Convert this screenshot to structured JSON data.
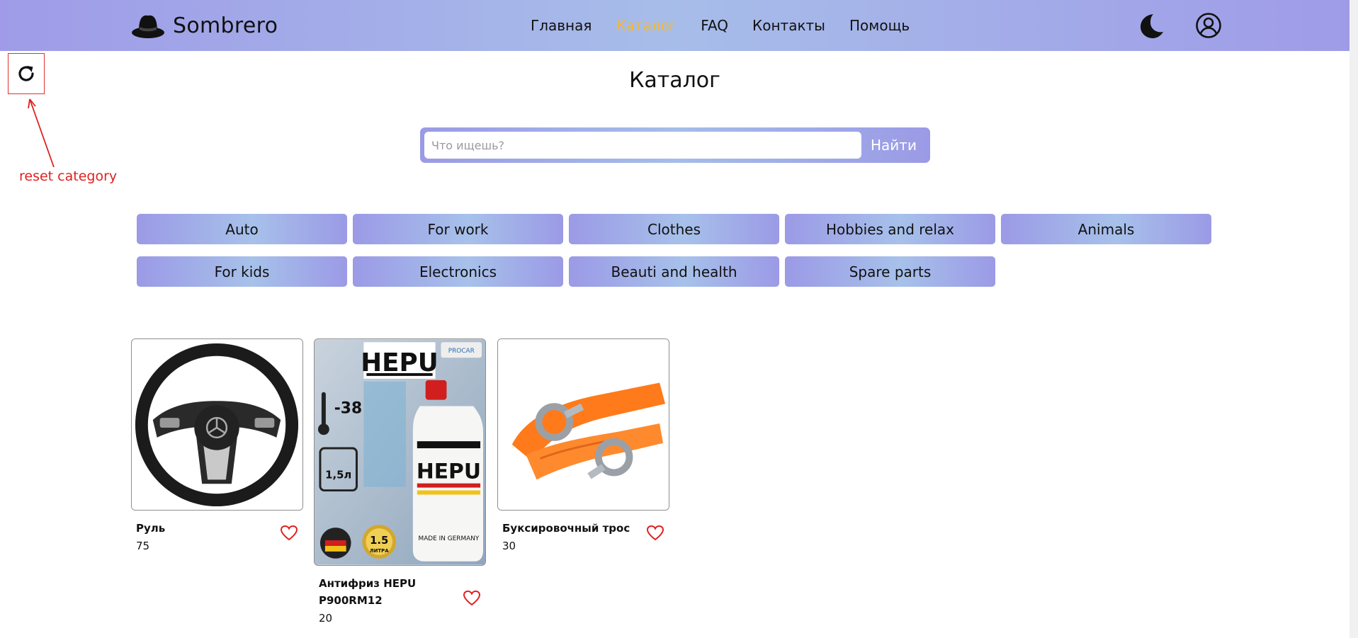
{
  "header": {
    "logo_text": "Sombrero",
    "logo_icon": "hat-icon",
    "nav": [
      {
        "label": "Главная",
        "active": false
      },
      {
        "label": "Каталог",
        "active": true
      },
      {
        "label": "FAQ",
        "active": false
      },
      {
        "label": "Контакты",
        "active": false
      },
      {
        "label": "Помощь",
        "active": false
      }
    ],
    "theme_icon": "moon-icon",
    "profile_icon": "user-circle-icon"
  },
  "annotation": {
    "label": "reset category",
    "icon": "refresh-icon",
    "color": "#e02020"
  },
  "page": {
    "title": "Каталог"
  },
  "search": {
    "placeholder": "Что ищешь?",
    "value": "",
    "button_label": "Найти"
  },
  "categories": [
    "Auto",
    "For work",
    "Clothes",
    "Hobbies and relax",
    "Animals",
    "For kids",
    "Electronics",
    "Beauti and health",
    "Spare parts"
  ],
  "products": [
    {
      "name_lines": [
        "Руль"
      ],
      "price": "75",
      "image": "steering-wheel-image"
    },
    {
      "name_lines": [
        "Антифриз HEPU",
        "P900RM12"
      ],
      "price": "20",
      "image": "antifreeze-bottle-image",
      "image_text": {
        "brand": "HEPU",
        "badge": "PROCAR",
        "temperature": "-38",
        "volume": "1,5л",
        "seal": "1.5",
        "seal_unit": "ЛИТРА",
        "bottle_tag": "MADE IN GERMANY"
      }
    },
    {
      "name_lines": [
        "Буксировочный трос"
      ],
      "price": "30",
      "image": "tow-strap-image"
    }
  ],
  "colors": {
    "header_gradient": [
      "#9f9be8",
      "#a7bde9"
    ],
    "nav_active": "#f5b82e",
    "favorite_icon": "#e02020",
    "annotation": "#e02020"
  }
}
